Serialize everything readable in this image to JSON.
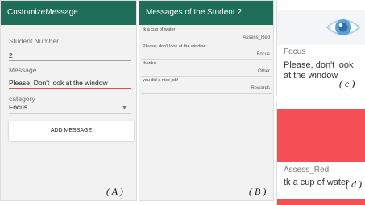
{
  "panel_a": {
    "title": "CustomizeMessage",
    "student_number_label": "Student Number",
    "student_number_value": "2",
    "message_label": "Message",
    "message_value": "Please, Don't look at the window",
    "category_label": "category",
    "category_selected": "Focus",
    "add_button_label": "ADD MESSAGE",
    "figure_label": "( A )"
  },
  "panel_b": {
    "title": "Messages of the Student 2",
    "messages": [
      {
        "text": "tk a cup of water",
        "category": "Assess_Red"
      },
      {
        "text": "Please, don't look at the window",
        "category": "Focus"
      },
      {
        "text": "thanks",
        "category": "Other"
      },
      {
        "text": "you did a nice job!",
        "category": "Rewards"
      }
    ],
    "figure_label": "( B )"
  },
  "panel_c": {
    "icon": "eye-icon",
    "category": "Focus",
    "message": "Please, don't look at the window",
    "figure_label": "( c )"
  },
  "panel_d": {
    "category": "Assess_Red",
    "message": "tk a cup of water",
    "figure_label": "( d )"
  },
  "colors": {
    "appbar": "#1f6e5a",
    "accent_underline": "#e0533e",
    "alert_red": "#f54e55",
    "panel_bg": "#f2f2f2"
  }
}
